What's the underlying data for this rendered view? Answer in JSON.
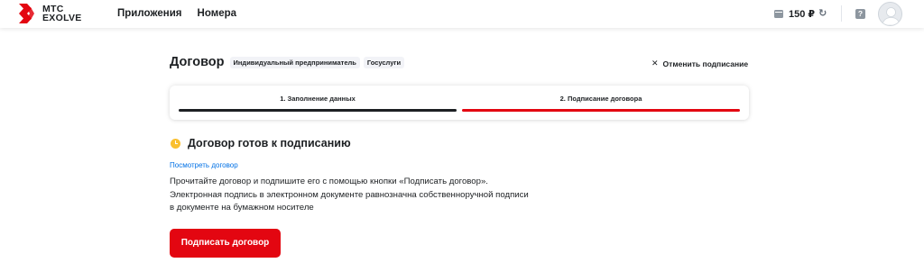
{
  "header": {
    "logo_line1": "МТС",
    "logo_line2": "EXOLVE",
    "nav": [
      "Приложения",
      "Номера"
    ],
    "balance": "150 ₽",
    "help_label": "?",
    "brand_color": "#e30611"
  },
  "page": {
    "title": "Договор",
    "badges": [
      "Индивидуальный предприниматель",
      "Госуслуги"
    ],
    "cancel_label": "Отменить подписание"
  },
  "stepper": {
    "steps": [
      {
        "label": "1. Заполнение данных",
        "state": "completed",
        "color": "#1d2023"
      },
      {
        "label": "2. Подписание договора",
        "state": "active",
        "color": "#e30611"
      }
    ]
  },
  "status": {
    "icon": "clock-icon",
    "title": "Договор готов к подписанию",
    "view_link": "Посмотреть договор",
    "description": [
      "Прочитайте договор и подпишите его с помощью кнопки «Подписать договор».",
      "Электронная подпись в электронном документе равнозначна собственноручной подписи",
      "в документе на бумажном носителе"
    ],
    "sign_button": "Подписать договор"
  }
}
